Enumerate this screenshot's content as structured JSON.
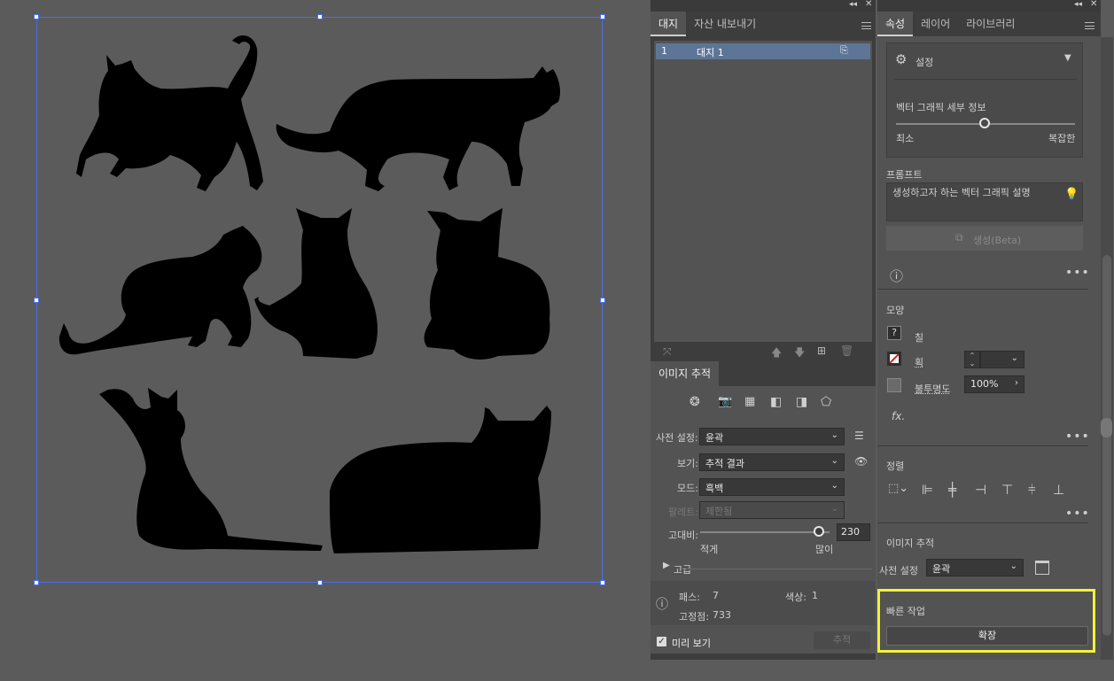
{
  "artboard_panel": {
    "tabs": [
      "대지",
      "자산 내보내기"
    ],
    "row_number": "1",
    "row_name": "대지 1"
  },
  "image_trace": {
    "title": "이미지 추적",
    "preset_label": "사전 설정:",
    "preset_value": "윤곽",
    "view_label": "보기:",
    "view_value": "추적 결과",
    "mode_label": "모드:",
    "mode_value": "흑백",
    "palette_label": "팔레트:",
    "palette_value": "제한됨",
    "contrast_label": "고대비:",
    "contrast_value": "230",
    "contrast_fraction": 0.92,
    "less_label": "적게",
    "more_label": "많이",
    "advanced_label": "고급",
    "paths_label": "패스:",
    "paths_value": "7",
    "colors_label": "색상:",
    "colors_value": "1",
    "anchors_label": "고정점:",
    "anchors_value": "733",
    "preview_label": "미리 보기",
    "trace_button": "추적"
  },
  "properties": {
    "tabs": [
      "속성",
      "레이어",
      "라이브러리"
    ],
    "settings_label": "설정",
    "vector_detail_label": "벡터 그래픽 세부 정보",
    "detail_min": "최소",
    "detail_max": "복잡한",
    "detail_fraction": 0.5,
    "prompt_label": "프롬프트",
    "prompt_placeholder": "생성하고자 하는 벡터 그래픽 설명",
    "generate_button": "생성(Beta)",
    "appearance_label": "모양",
    "fill_label": "칠",
    "stroke_label": "획",
    "opacity_label": "불투명도",
    "opacity_value": "100%",
    "fx_label": "fx.",
    "align_label": "정렬",
    "image_trace_label": "이미지 추적",
    "preset_label": "사전 설정",
    "preset_value": "윤곽",
    "quick_actions_label": "빠른 작업",
    "expand_button": "확장",
    "highlight_color": "#f2f23a"
  }
}
